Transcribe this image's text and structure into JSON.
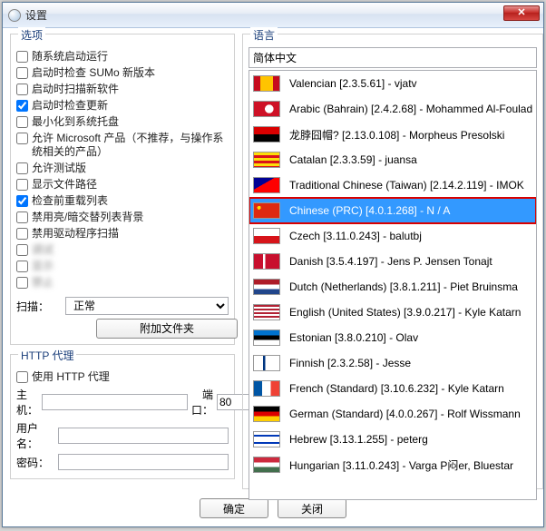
{
  "window": {
    "title": "设置"
  },
  "options": {
    "group_label": "选项",
    "items": [
      {
        "key": "startup",
        "label": "随系统启动运行",
        "checked": false
      },
      {
        "key": "sumo",
        "label": "启动时检查 SUMo 新版本",
        "checked": false
      },
      {
        "key": "scan_new",
        "label": "启动时扫描新软件",
        "checked": false
      },
      {
        "key": "check_update",
        "label": "启动时检查更新",
        "checked": true
      },
      {
        "key": "tray",
        "label": "最小化到系统托盘",
        "checked": false
      },
      {
        "key": "msprod",
        "label": "允许 Microsoft 产品（不推荐，与操作系统相关的产品）",
        "checked": false
      },
      {
        "key": "beta",
        "label": "允许测试版",
        "checked": false
      },
      {
        "key": "showpath",
        "label": "显示文件路径",
        "checked": false
      },
      {
        "key": "checklist",
        "label": "检查前重载列表",
        "checked": true
      },
      {
        "key": "disable_bg",
        "label": "禁用亮/暗交替列表背景",
        "checked": false
      },
      {
        "key": "disable_drv",
        "label": "禁用驱动程序扫描",
        "checked": false
      },
      {
        "key": "x1",
        "label": "调试",
        "checked": false,
        "obscured": true
      },
      {
        "key": "x2",
        "label": "显示",
        "checked": false,
        "obscured": true
      },
      {
        "key": "x3",
        "label": "禁止",
        "checked": false,
        "obscured": true
      }
    ],
    "scan_label": "扫描：",
    "scan_value": "正常",
    "attach_label": "附加文件夹"
  },
  "proxy": {
    "group_label": "HTTP 代理",
    "use_label": "使用 HTTP 代理",
    "use_checked": false,
    "host_label": "主机：",
    "host_value": "",
    "port_label": "端口：",
    "port_value": "80",
    "user_label": "用户名：",
    "user_value": "",
    "pass_label": "密码：",
    "pass_value": ""
  },
  "lang": {
    "group_label": "语言",
    "header": "简体中文",
    "items": [
      {
        "flag": "f-val",
        "text": "Valencian [2.3.5.61] - vjatv"
      },
      {
        "flag": "f-ara",
        "text": "Arabic (Bahrain) [2.4.2.68] - Mohammed Al-Foulad"
      },
      {
        "flag": "f-png",
        "text": "龙脖囧帽? [2.13.0.108] - Morpheus Presolski"
      },
      {
        "flag": "f-cat",
        "text": "Catalan [2.3.3.59] - juansa"
      },
      {
        "flag": "f-twn",
        "text": "Traditional Chinese (Taiwan) [2.14.2.119] - IMOK"
      },
      {
        "flag": "f-prc",
        "text": "Chinese (PRC) [4.0.1.268] - N / A",
        "selected": true
      },
      {
        "flag": "f-cze",
        "text": "Czech [3.11.0.243] - balutbj"
      },
      {
        "flag": "f-dan",
        "text": "Danish [3.5.4.197] - Jens P. Jensen Tonajt"
      },
      {
        "flag": "f-dut",
        "text": "Dutch (Netherlands) [3.8.1.211] - Piet Bruinsma"
      },
      {
        "flag": "f-eng",
        "text": "English (United States) [3.9.0.217] - Kyle Katarn"
      },
      {
        "flag": "f-est",
        "text": "Estonian [3.8.0.210] - Olav"
      },
      {
        "flag": "f-fin",
        "text": "Finnish [2.3.2.58] - Jesse"
      },
      {
        "flag": "f-fre",
        "text": "French (Standard) [3.10.6.232] - Kyle Katarn"
      },
      {
        "flag": "f-ger",
        "text": "German (Standard) [4.0.0.267] - Rolf Wissmann"
      },
      {
        "flag": "f-heb",
        "text": "Hebrew [3.13.1.255] - peterg"
      },
      {
        "flag": "f-hun",
        "text": "Hungarian [3.11.0.243] - Varga P闷er, Bluestar"
      }
    ]
  },
  "footer": {
    "ok": "确定",
    "close": "关闭"
  }
}
